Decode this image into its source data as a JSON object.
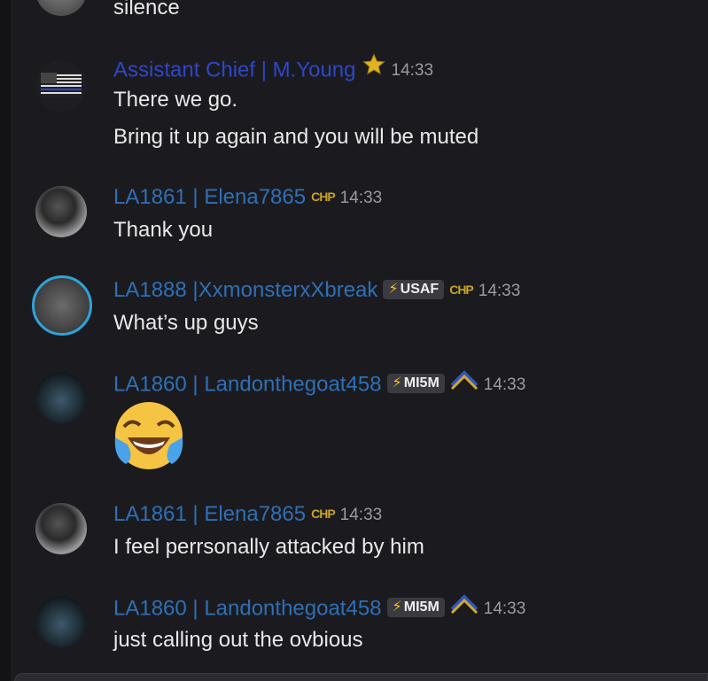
{
  "messages": [
    {
      "type": "continuation",
      "text": "silence"
    },
    {
      "author": "Assistant Chief | M.Young",
      "author_color": "#2e46c9",
      "decoration": "star-icon",
      "timestamp": "14:33",
      "lines": [
        "There we go.",
        "Bring it up again and you will be muted"
      ]
    },
    {
      "author": "LA1861 | Elena7865",
      "tag": "CHP",
      "timestamp": "14:33",
      "lines": [
        "Thank you"
      ]
    },
    {
      "author": "LA1888 |XxmonsterxXbreak",
      "badge": "USAF",
      "tag": "CHP",
      "timestamp": "14:33",
      "lines": [
        "What’s up guys"
      ]
    },
    {
      "author": "LA1860 | Landonthegoat458",
      "badge": "MI5M",
      "decoration": "chevron-rank-icon",
      "timestamp": "14:33",
      "emoji": "face-with-tears-of-joy"
    },
    {
      "author": "LA1861 | Elena7865",
      "tag": "CHP",
      "timestamp": "14:33",
      "lines": [
        "I feel perrsonally attacked by him"
      ]
    },
    {
      "author": "LA1860 | Landonthegoat458",
      "badge": "MI5M",
      "decoration": "chevron-rank-icon",
      "timestamp": "14:33",
      "lines": [
        "just calling out the ovbious"
      ]
    }
  ],
  "colors": {
    "background": "#1b1b1f",
    "name_default": "#2f6fb6",
    "name_chief": "#2e46c9",
    "timestamp": "#9a9aa2",
    "badge_bg": "#3a3a41"
  }
}
